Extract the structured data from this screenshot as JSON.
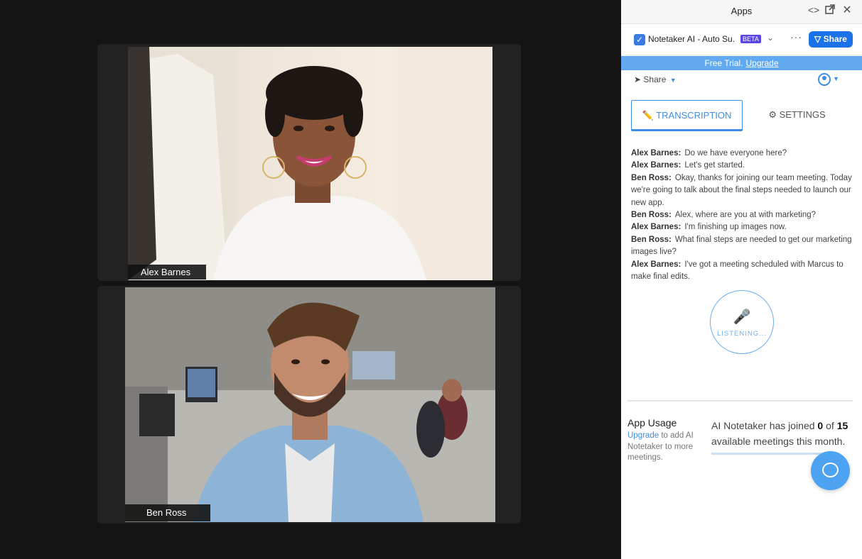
{
  "video": {
    "participants": [
      {
        "name": "Alex Barnes"
      },
      {
        "name": "Ben Ross"
      }
    ]
  },
  "panel": {
    "title": "Apps",
    "app_name": "Notetaker AI - Auto Su...",
    "beta_label": "BETA",
    "share_button": "Share",
    "trial": {
      "text": "Free Trial.",
      "upgrade": "Upgrade"
    },
    "share_link": "Share",
    "tabs": {
      "transcription": "TRANSCRIPTION",
      "settings": "SETTINGS"
    },
    "transcript": [
      {
        "speaker": "Alex Barnes:",
        "text": "Do we have everyone here?"
      },
      {
        "speaker": "Alex Barnes:",
        "text": "Let's get started."
      },
      {
        "speaker": "Ben Ross:",
        "text": "Okay, thanks for joining our team meeting. Today we're going to talk about the final steps needed to launch our new app."
      },
      {
        "speaker": "Ben Ross:",
        "text": "Alex, where are you at with marketing?"
      },
      {
        "speaker": "Alex Barnes:",
        "text": "I'm finishing up images now."
      },
      {
        "speaker": "Ben Ross:",
        "text": "What final steps are needed to get our marketing images live?"
      },
      {
        "speaker": "Alex Barnes:",
        "text": "I've got a meeting scheduled with Marcus to make final edits."
      }
    ],
    "listening_label": "LISTENING...",
    "usage": {
      "title": "App Usage",
      "upgrade_link": "Upgrade",
      "desc_rest": " to add AI Notetaker to more meetings.",
      "count_prefix": "AI Notetaker has joined ",
      "joined": "0",
      "count_mid": " of ",
      "total": "15",
      "count_suffix": " available meetings this month.",
      "progress_fraction": 0
    }
  },
  "icons": {
    "code": "code-icon",
    "popout": "popout-icon",
    "close": "close-icon",
    "pencil": "pencil-icon",
    "gear": "gear-icon",
    "mic": "microphone-icon",
    "chat": "chat-icon",
    "user": "user-icon",
    "send": "send-icon"
  },
  "colors": {
    "accent": "#3e8ee6",
    "share_button": "#1b72e8",
    "trial_bar": "#62aaf0",
    "beta_badge": "#5a46e0",
    "chat_button": "#4da3f2",
    "stage_bg": "#141414"
  }
}
